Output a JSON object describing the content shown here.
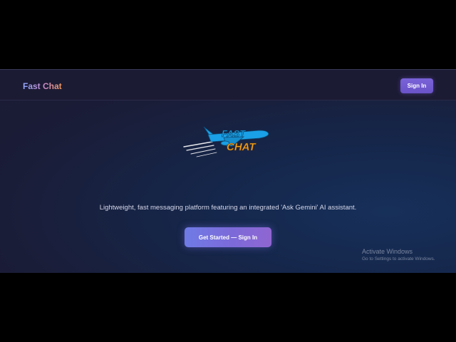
{
  "header": {
    "brand": "Fast Chat",
    "signin_label": "Sign In"
  },
  "hero": {
    "logo_line1": "FAST",
    "logo_line2": "CHAT",
    "tagline": "Lightweight, fast messaging platform featuring an integrated 'Ask Gemini' AI assistant.",
    "cta_label": "Get Started — Sign In"
  },
  "watermark": {
    "title": "Activate Windows",
    "subtitle": "Go to Settings to activate Windows."
  },
  "colors": {
    "accent": "#7a62d9",
    "logo_blue": "#1aa0e6",
    "logo_orange": "#f5a623"
  }
}
